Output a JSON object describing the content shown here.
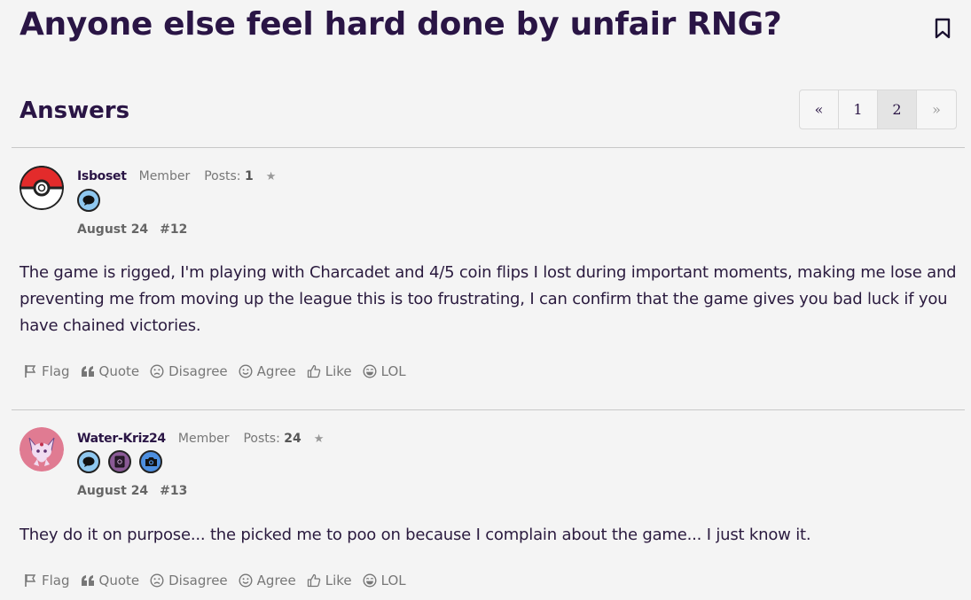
{
  "thread": {
    "title": "Anyone else feel hard done by unfair RNG?",
    "answers_heading": "Answers"
  },
  "pager": {
    "prev": "«",
    "pages": [
      "1",
      "2"
    ],
    "current": "2",
    "next": "»"
  },
  "posts": [
    {
      "username": "Isboset",
      "role": "Member",
      "posts_label": "Posts:",
      "posts_count": "1",
      "date": "August 24",
      "number": "#12",
      "badges": [
        "speech-bubble-badge"
      ],
      "body": "The game is rigged, I'm playing with Charcadet and 4/5 coin flips I lost during important moments, making me lose and preventing me from moving up the league this is too frustrating, I can confirm that the game gives you bad luck if you have chained victories."
    },
    {
      "username": "Water-Kriz24",
      "role": "Member",
      "posts_label": "Posts:",
      "posts_count": "24",
      "date": "August 24",
      "number": "#13",
      "badges": [
        "speech-bubble-badge",
        "notebook-badge",
        "camera-badge"
      ],
      "body": "They do it on purpose... the picked me to poo on because I complain about the game... I just know it."
    }
  ],
  "actions": {
    "flag": "Flag",
    "quote": "Quote",
    "disagree": "Disagree",
    "agree": "Agree",
    "like": "Like",
    "lol": "LOL"
  },
  "colors": {
    "title": "#2a1545",
    "background": "#f4f4f4",
    "muted": "#777777"
  }
}
